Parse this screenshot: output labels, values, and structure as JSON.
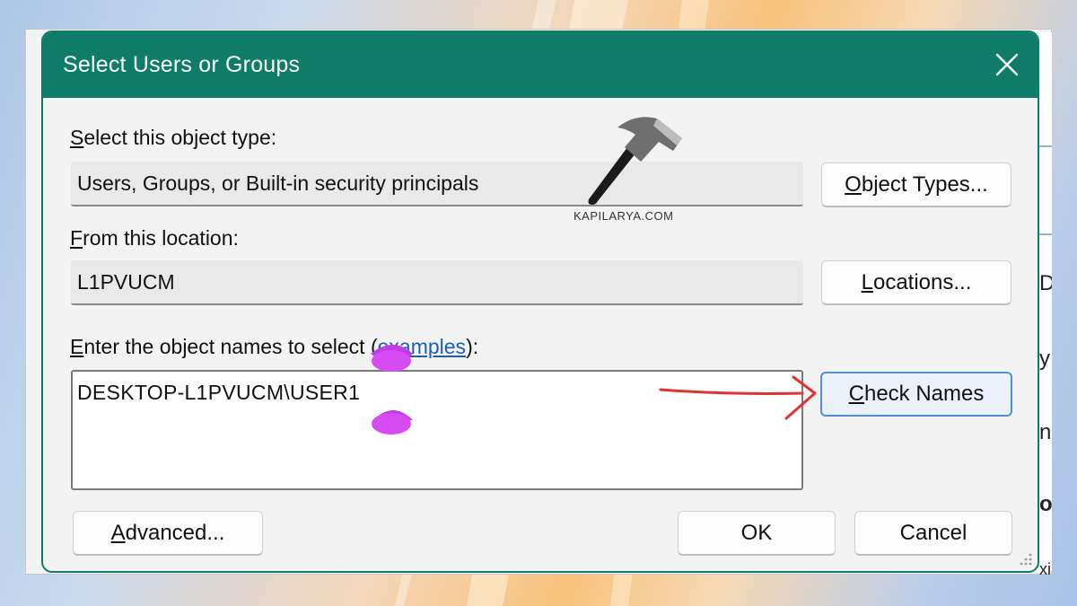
{
  "dialog": {
    "title": "Select Users or Groups",
    "object_type_label": "Select this object type:",
    "object_type_value": "Users, Groups, or Built-in security principals",
    "location_label": "From this location:",
    "location_value": "L1PVUCM",
    "names_label_prefix": "Enter the object names to select (",
    "names_label_link": "examples",
    "names_label_suffix": "):",
    "names_value": "DESKTOP-L1PVUCM\\USER1",
    "buttons": {
      "object_types": "Object Types...",
      "locations": "Locations...",
      "check_names": "Check Names",
      "advanced": "Advanced...",
      "ok": "OK",
      "cancel": "Cancel"
    },
    "accent_color": "#0e7c66"
  },
  "watermark": {
    "text": "KAPILARYA.COM",
    "icon": "hammer-icon"
  },
  "background_fragments": [
    "D",
    "y:",
    "ns",
    "ot",
    "xi"
  ]
}
